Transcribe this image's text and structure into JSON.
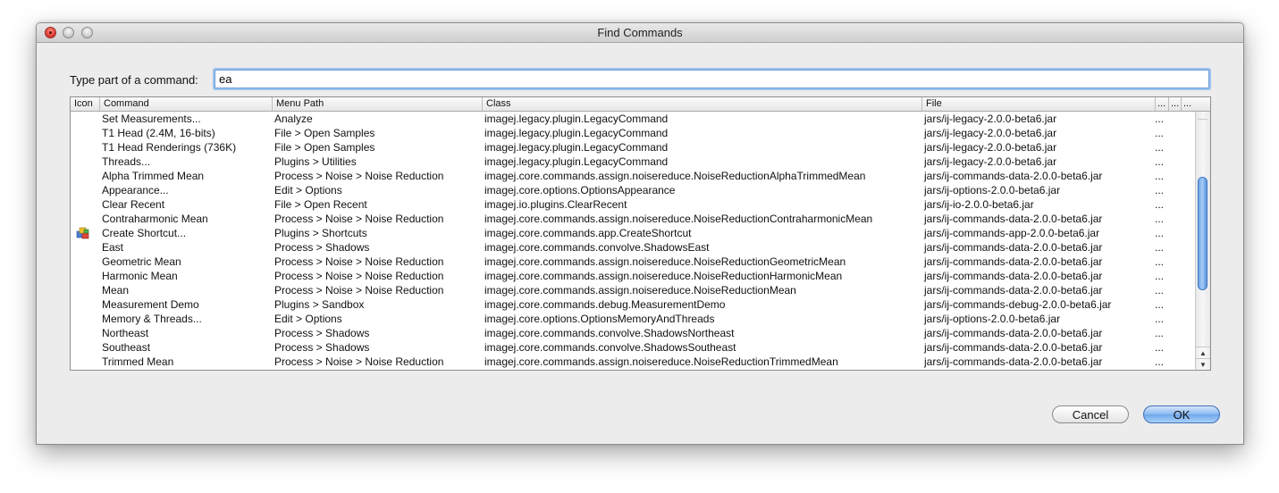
{
  "window": {
    "title": "Find Commands"
  },
  "search": {
    "label": "Type part of a command:",
    "value": "ea"
  },
  "table": {
    "headers": {
      "icon": "Icon",
      "command": "Command",
      "menu_path": "Menu Path",
      "class": "Class",
      "file": "File",
      "extra1": "...",
      "extra2": "...",
      "extra3": "..."
    },
    "rows": [
      {
        "icon": "",
        "command": "Set Measurements...",
        "menu_path": "Analyze",
        "class": "imagej.legacy.plugin.LegacyCommand",
        "file": "jars/ij-legacy-2.0.0-beta6.jar",
        "extra": "..."
      },
      {
        "icon": "",
        "command": "T1 Head (2.4M, 16-bits)",
        "menu_path": "File > Open Samples",
        "class": "imagej.legacy.plugin.LegacyCommand",
        "file": "jars/ij-legacy-2.0.0-beta6.jar",
        "extra": "..."
      },
      {
        "icon": "",
        "command": "T1 Head Renderings (736K)",
        "menu_path": "File > Open Samples",
        "class": "imagej.legacy.plugin.LegacyCommand",
        "file": "jars/ij-legacy-2.0.0-beta6.jar",
        "extra": "..."
      },
      {
        "icon": "",
        "command": "Threads...",
        "menu_path": "Plugins > Utilities",
        "class": "imagej.legacy.plugin.LegacyCommand",
        "file": "jars/ij-legacy-2.0.0-beta6.jar",
        "extra": "..."
      },
      {
        "icon": "",
        "command": "Alpha Trimmed Mean",
        "menu_path": "Process > Noise > Noise Reduction",
        "class": "imagej.core.commands.assign.noisereduce.NoiseReductionAlphaTrimmedMean",
        "file": "jars/ij-commands-data-2.0.0-beta6.jar",
        "extra": "..."
      },
      {
        "icon": "",
        "command": "Appearance...",
        "menu_path": "Edit > Options",
        "class": "imagej.core.options.OptionsAppearance",
        "file": "jars/ij-options-2.0.0-beta6.jar",
        "extra": "..."
      },
      {
        "icon": "",
        "command": "Clear Recent",
        "menu_path": "File > Open Recent",
        "class": "imagej.io.plugins.ClearRecent",
        "file": "jars/ij-io-2.0.0-beta6.jar",
        "extra": "..."
      },
      {
        "icon": "",
        "command": "Contraharmonic Mean",
        "menu_path": "Process > Noise > Noise Reduction",
        "class": "imagej.core.commands.assign.noisereduce.NoiseReductionContraharmonicMean",
        "file": "jars/ij-commands-data-2.0.0-beta6.jar",
        "extra": "..."
      },
      {
        "icon": "shortcut",
        "command": "Create Shortcut...",
        "menu_path": "Plugins > Shortcuts",
        "class": "imagej.core.commands.app.CreateShortcut",
        "file": "jars/ij-commands-app-2.0.0-beta6.jar",
        "extra": "..."
      },
      {
        "icon": "",
        "command": "East",
        "menu_path": "Process > Shadows",
        "class": "imagej.core.commands.convolve.ShadowsEast",
        "file": "jars/ij-commands-data-2.0.0-beta6.jar",
        "extra": "..."
      },
      {
        "icon": "",
        "command": "Geometric Mean",
        "menu_path": "Process > Noise > Noise Reduction",
        "class": "imagej.core.commands.assign.noisereduce.NoiseReductionGeometricMean",
        "file": "jars/ij-commands-data-2.0.0-beta6.jar",
        "extra": "..."
      },
      {
        "icon": "",
        "command": "Harmonic Mean",
        "menu_path": "Process > Noise > Noise Reduction",
        "class": "imagej.core.commands.assign.noisereduce.NoiseReductionHarmonicMean",
        "file": "jars/ij-commands-data-2.0.0-beta6.jar",
        "extra": "..."
      },
      {
        "icon": "",
        "command": "Mean",
        "menu_path": "Process > Noise > Noise Reduction",
        "class": "imagej.core.commands.assign.noisereduce.NoiseReductionMean",
        "file": "jars/ij-commands-data-2.0.0-beta6.jar",
        "extra": "..."
      },
      {
        "icon": "",
        "command": "Measurement Demo",
        "menu_path": "Plugins > Sandbox",
        "class": "imagej.core.commands.debug.MeasurementDemo",
        "file": "jars/ij-commands-debug-2.0.0-beta6.jar",
        "extra": "..."
      },
      {
        "icon": "",
        "command": "Memory & Threads...",
        "menu_path": "Edit > Options",
        "class": "imagej.core.options.OptionsMemoryAndThreads",
        "file": "jars/ij-options-2.0.0-beta6.jar",
        "extra": "..."
      },
      {
        "icon": "",
        "command": "Northeast",
        "menu_path": "Process > Shadows",
        "class": "imagej.core.commands.convolve.ShadowsNortheast",
        "file": "jars/ij-commands-data-2.0.0-beta6.jar",
        "extra": "..."
      },
      {
        "icon": "",
        "command": "Southeast",
        "menu_path": "Process > Shadows",
        "class": "imagej.core.commands.convolve.ShadowsSoutheast",
        "file": "jars/ij-commands-data-2.0.0-beta6.jar",
        "extra": "..."
      },
      {
        "icon": "",
        "command": "Trimmed Mean",
        "menu_path": "Process > Noise > Noise Reduction",
        "class": "imagej.core.commands.assign.noisereduce.NoiseReductionTrimmedMean",
        "file": "jars/ij-commands-data-2.0.0-beta6.jar",
        "extra": "..."
      }
    ],
    "scroll_position": 0.5
  },
  "buttons": {
    "cancel": "Cancel",
    "ok": "OK"
  },
  "colors": {
    "accent": "#6ea6ea",
    "close": "#e0443a"
  },
  "icons": {
    "close": "close-window-icon",
    "minimize": "minimize-window-icon",
    "zoom": "zoom-window-icon",
    "shortcut": "shortcut-icon",
    "scroll_up": "scroll-up-arrow-icon",
    "scroll_down": "scroll-down-arrow-icon"
  }
}
